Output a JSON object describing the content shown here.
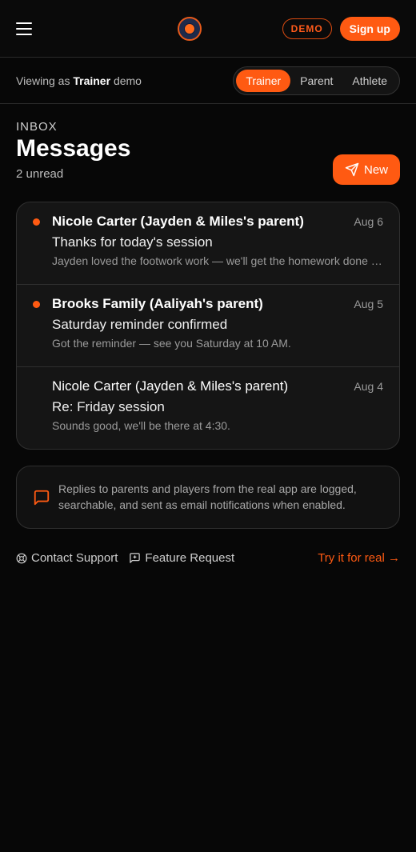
{
  "topbar": {
    "demo_badge": "DEMO",
    "signup_label": "Sign up"
  },
  "rolebar": {
    "viewing_prefix": "Viewing as",
    "viewing_role": "Trainer",
    "viewing_suffix": "demo",
    "roles": [
      "Trainer",
      "Parent",
      "Athlete"
    ],
    "active_role": "Trainer"
  },
  "header": {
    "section_label": "INBOX",
    "title": "Messages",
    "unread": "2 unread",
    "new_label": "New"
  },
  "messages": [
    {
      "sender": "Nicole Carter (Jayden & Miles's parent)",
      "date": "Aug 6",
      "subject": "Thanks for today's session",
      "preview": "Jayden loved the footwork work — we'll get the homework done this week.",
      "unread": true
    },
    {
      "sender": "Brooks Family (Aaliyah's parent)",
      "date": "Aug 5",
      "subject": "Saturday reminder confirmed",
      "preview": "Got the reminder — see you Saturday at 10 AM.",
      "unread": true
    },
    {
      "sender": "Nicole Carter (Jayden & Miles's parent)",
      "date": "Aug 4",
      "subject": "Re: Friday session",
      "preview": "Sounds good, we'll be there at 4:30.",
      "unread": false
    }
  ],
  "notice": {
    "text": "Replies to parents and players from the real app are logged, searchable, and sent as email notifications when enabled."
  },
  "footer": {
    "contact_support": "Contact Support",
    "feature_request": "Feature Request",
    "try_it": "Try it for real →"
  },
  "colors": {
    "accent": "#ff5a12",
    "background": "#070707",
    "card": "#151515"
  },
  "icons": [
    "menu-icon",
    "logo",
    "send-icon",
    "message-square-icon",
    "life-buoy-icon",
    "message-plus-icon"
  ]
}
